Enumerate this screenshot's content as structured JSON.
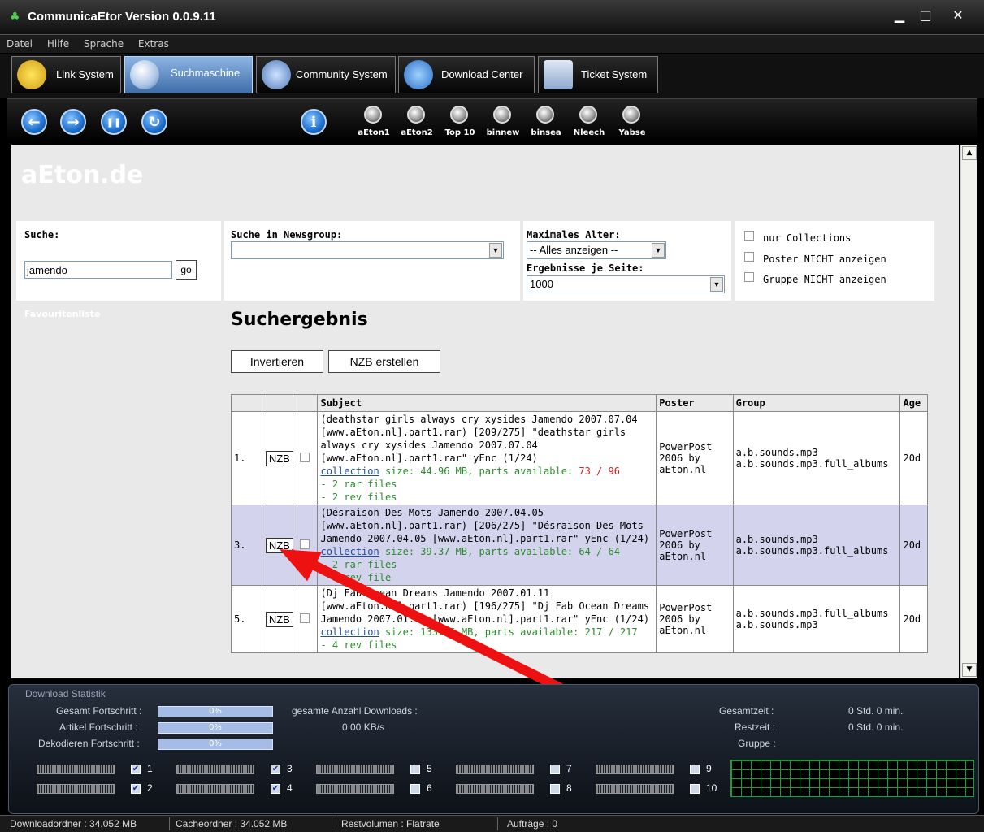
{
  "window": {
    "title": "CommunicaEtor Version 0.0.9.11",
    "min": "▁",
    "max": "□",
    "close": "✕"
  },
  "menu": [
    "Datei",
    "Hilfe",
    "Sprache",
    "Extras"
  ],
  "tabs": [
    {
      "label": "Link System",
      "icon": "star-icon",
      "active": false
    },
    {
      "label": "Suchmaschine",
      "icon": "magnifier-icon",
      "active": true
    },
    {
      "label": "Community System",
      "icon": "people-icon",
      "active": false
    },
    {
      "label": "Download Center",
      "icon": "download-icon",
      "active": false
    },
    {
      "label": "Ticket System",
      "icon": "calculator-icon",
      "active": false
    }
  ],
  "toolbar": {
    "nav": [
      {
        "name": "back",
        "glyph": "←"
      },
      {
        "name": "forward",
        "glyph": "→"
      },
      {
        "name": "pause",
        "glyph": "❚❚"
      },
      {
        "name": "refresh",
        "glyph": "↻"
      },
      {
        "name": "info",
        "glyph": "i"
      }
    ],
    "search_engines": [
      "aEton1",
      "aEton2",
      "Top 10",
      "binnew",
      "binsea",
      "Nleech",
      "Yabse"
    ]
  },
  "page": {
    "site_title": "aEton.de",
    "search": {
      "label": "Suche:",
      "value": "jamendo",
      "go": "go"
    },
    "newsgroup": {
      "label": "Suche in Newsgroup:",
      "value": ""
    },
    "max_age": {
      "label": "Maximales Alter:",
      "value": "-- Alles anzeigen --"
    },
    "per_page": {
      "label": "Ergebnisse je Seite:",
      "value": "1000"
    },
    "options": [
      "nur Collections",
      "Poster NICHT anzeigen",
      "Gruppe NICHT anzeigen"
    ],
    "favourites": "Favouritenliste",
    "results_title": "Suchergebnis",
    "buttons": {
      "invert": "Invertieren",
      "create_nzb": "NZB erstellen"
    },
    "table": {
      "headers": [
        "Subject",
        "Poster",
        "Group",
        "Age"
      ],
      "rows": [
        {
          "num": "1.",
          "nzb": "NZB",
          "subject": "(deathstar girls always cry xysides Jamendo 2007.07.04 [www.aEton.nl].part1.rar) [209/275] \"deathstar girls always cry xysides Jamendo 2007.07.04 [www.aEton.nl].part1.rar\" yEnc (1/24)",
          "link": "collection",
          "size": "size: 44.96 MB, parts available: ",
          "parts": "73 / 96",
          "parts_color": "red",
          "files": [
            "- 2 rar files",
            "- 2 rev files"
          ],
          "poster": "PowerPost 2006 by aEton.nl",
          "group": "a.b.sounds.mp3 a.b.sounds.mp3.full_albums",
          "age": "20d"
        },
        {
          "num": "3.",
          "nzb": "NZB",
          "subject": "(Désraison Des Mots Jamendo 2007.04.05 [www.aEton.nl].part1.rar) [206/275] \"Désraison Des Mots Jamendo 2007.04.05 [www.aEton.nl].part1.rar\" yEnc (1/24)",
          "link": "collection",
          "size": "size: 39.37 MB, parts available: ",
          "parts": "64 / 64",
          "parts_color": "green",
          "files": [
            "- 2 rar files",
            "- 1 rev file"
          ],
          "poster": "PowerPost 2006 by aEton.nl",
          "group": "a.b.sounds.mp3 a.b.sounds.mp3.full_albums",
          "age": "20d"
        },
        {
          "num": "5.",
          "nzb": "NZB",
          "subject": "(Dj Fab Ocean Dreams Jamendo 2007.01.11 [www.aEton.nl].part1.rar) [196/275] \"Dj Fab Ocean Dreams Jamendo 2007.01.11 [www.aEton.nl].part1.rar\" yEnc (1/24)",
          "link": "collection",
          "size": "size: 133.15 MB, parts available: ",
          "parts": "217 / 217",
          "parts_color": "green",
          "files": [
            "- 4 rev files"
          ],
          "poster": "PowerPost 2006 by aEton.nl",
          "group": "a.b.sounds.mp3.full_albums a.b.sounds.mp3",
          "age": "20d"
        }
      ]
    }
  },
  "stats": {
    "title": "Download Statistik",
    "progress": [
      {
        "label": "Gesamt Fortschritt :",
        "value": "0%"
      },
      {
        "label": "Artikel Fortschritt :",
        "value": "0%"
      },
      {
        "label": "Dekodieren Fortschritt :",
        "value": "0%"
      }
    ],
    "downloads_label": "gesamte Anzahl Downloads :",
    "speed": "0.00 KB/s",
    "right": [
      {
        "label": "Gesamtzeit :",
        "value": "0 Std. 0 min."
      },
      {
        "label": "Restzeit :",
        "value": "0 Std. 0 min."
      },
      {
        "label": "Gruppe :",
        "value": ""
      }
    ],
    "slots": [
      {
        "n": "1",
        "checked": true
      },
      {
        "n": "2",
        "checked": true
      },
      {
        "n": "3",
        "checked": true
      },
      {
        "n": "4",
        "checked": true
      },
      {
        "n": "5",
        "checked": false
      },
      {
        "n": "6",
        "checked": false
      },
      {
        "n": "7",
        "checked": false
      },
      {
        "n": "8",
        "checked": false
      },
      {
        "n": "9",
        "checked": false
      },
      {
        "n": "10",
        "checked": false
      }
    ]
  },
  "statusbar": {
    "download_folder": "Downloadordner : 34.052 MB",
    "cache_folder": "Cacheordner : 34.052 MB",
    "rest": "Restvolumen : Flatrate",
    "jobs": "Aufträge : 0"
  },
  "colors": {
    "accent": "#3f6ea9",
    "alt_row": "#d3d3ee",
    "arrow": "#ee1111"
  }
}
